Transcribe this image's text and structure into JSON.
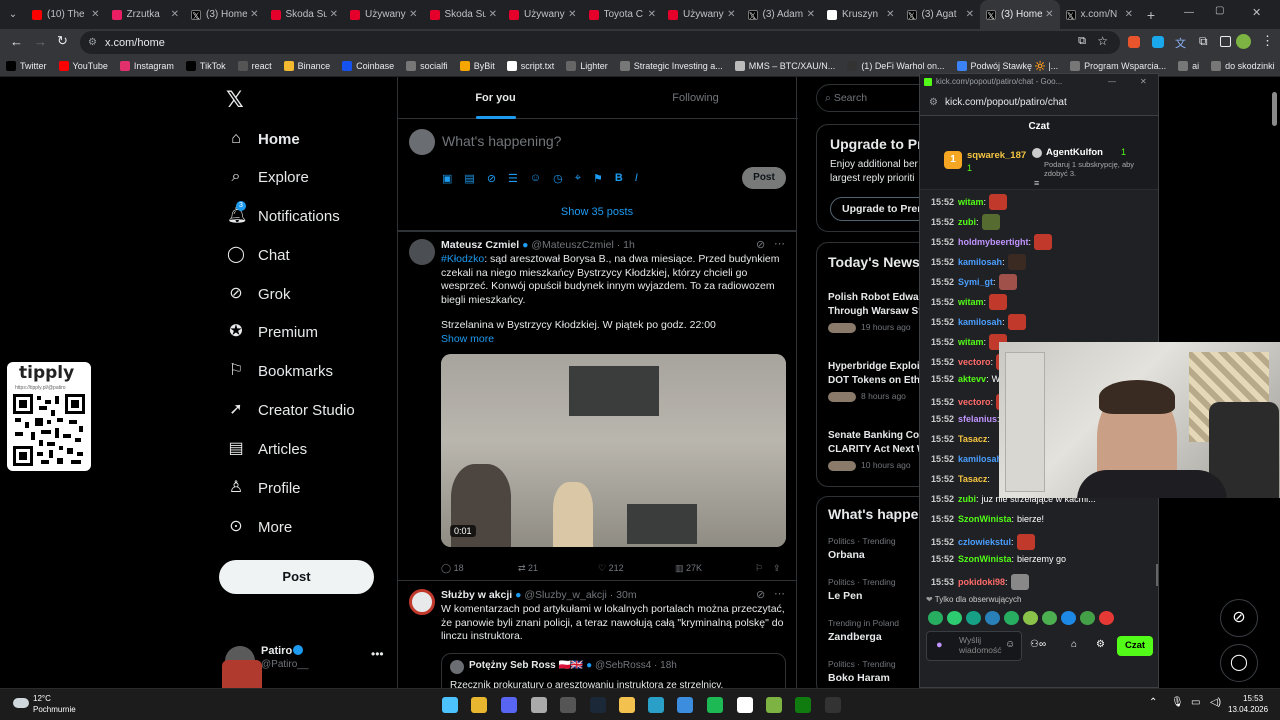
{
  "tabs": [
    {
      "title": "(10) The",
      "icon": "youtube-icon",
      "color": "#ff0000"
    },
    {
      "title": "Zrzutka",
      "icon": "zrzutka-icon",
      "color": "#e91e63"
    },
    {
      "title": "(3) Home",
      "icon": "x-icon",
      "color": "#000000"
    },
    {
      "title": "Skoda Su",
      "icon": "otomoto-icon",
      "color": "#e4002b"
    },
    {
      "title": "Używany",
      "icon": "otomoto-icon",
      "color": "#e4002b"
    },
    {
      "title": "Skoda Su",
      "icon": "otomoto-icon",
      "color": "#e4002b"
    },
    {
      "title": "Używany",
      "icon": "otomoto-icon",
      "color": "#e4002b"
    },
    {
      "title": "Toyota C",
      "icon": "toyota-icon",
      "color": "#e4002b"
    },
    {
      "title": "Używany",
      "icon": "otomoto-icon",
      "color": "#e4002b"
    },
    {
      "title": "(3) Adam",
      "icon": "x-icon",
      "color": "#000000"
    },
    {
      "title": "Kruszyn",
      "icon": "github-icon",
      "color": "#ffffff"
    },
    {
      "title": "(3) Agat",
      "icon": "x-icon",
      "color": "#000000"
    },
    {
      "title": "(3) Home",
      "icon": "x-icon",
      "color": "#000000"
    },
    {
      "title": "x.com/N",
      "icon": "x-icon",
      "color": "#000000"
    }
  ],
  "url": "x.com/home",
  "bookmarks": [
    "Twitter",
    "YouTube",
    "Instagram",
    "TikTok",
    "react",
    "Binance",
    "Coinbase",
    "socialfi",
    "ByBit",
    "script.txt",
    "Lighter",
    "Strategic Investing a...",
    "MMS – BTC/XAU/N...",
    "(1) DeFi Warhol on...",
    "Podwój Stawkę 🔆 |...",
    "Program Wsparcia...",
    "ai",
    "do skodzinki"
  ],
  "nav": {
    "home": "Home",
    "explore": "Explore",
    "notifications": "Notifications",
    "notif_badge": "3",
    "chat": "Chat",
    "grok": "Grok",
    "premium": "Premium",
    "bookmarks": "Bookmarks",
    "creator": "Creator Studio",
    "articles": "Articles",
    "profile": "Profile",
    "more": "More",
    "post": "Post"
  },
  "account": {
    "name": "Patiro",
    "handle": "@Patiro__"
  },
  "feed": {
    "tab_foryou": "For you",
    "tab_following": "Following",
    "composer": "What's happening?",
    "post": "Post",
    "show_posts": "Show 35 posts"
  },
  "tweet1": {
    "name": "Mateusz Czmiel",
    "handle": "@MateuszCzmiel · 1h",
    "hashtag": "#Kłodzko",
    "text": ": sąd aresztował Borysa B., na dwa miesiące. Przed budynkiem czekali na niego mieszkańcy Bystrzycy Kłodzkiej, którzy chcieli go wesprzeć. Konwój opuścił budynek innym wyjazdem. To za radiowozem biegli mieszkańcy.",
    "text2": "Strzelanina w Bystrzycy Kłodzkiej. W piątek po godz. 22:00",
    "more": "Show more",
    "duration": "0:01",
    "replies": "18",
    "reposts": "21",
    "likes": "212",
    "views": "27K"
  },
  "tweet2": {
    "name": "Służby w akcji",
    "handle": "@Sluzby_w_akcji · 30m",
    "text": "W komentarzach pod artykułami w lokalnych portalach można przeczytać, że panowie byli znani policji, a teraz nawołują całą \"kryminalną polskę\" do linczu instruktora.",
    "quote_name": "Potężny Seb Ross 🇵🇱🇬🇧",
    "quote_handle": "@SebRoss4 · 18h",
    "quote_text": "Rzecznik prokuratury o aresztowaniu instruktora ze strzelnicy."
  },
  "right": {
    "search": "Search",
    "premium_title": "Upgrade to Pre",
    "premium_text": "Enjoy additional ber largest reply prioriti",
    "premium_btn": "Upgrade to Prem",
    "news_title": "Today's News",
    "news": [
      {
        "t": "Polish Robot Edwar Through Warsaw St",
        "m": "19 hours ago"
      },
      {
        "t": "Hyperbridge Exploi DOT Tokens on Eth",
        "m": "8 hours ago"
      },
      {
        "t": "Senate Banking Co CLARITY Act Next W",
        "m": "10 hours ago"
      }
    ],
    "happening": "What's happen",
    "trends": [
      {
        "c": "Politics · Trending",
        "t": "Orbana"
      },
      {
        "c": "Politics · Trending",
        "t": "Le Pen"
      },
      {
        "c": "Trending in Poland",
        "t": "Zandberga"
      },
      {
        "c": "Politics · Trending",
        "t": "Boko Haram"
      }
    ]
  },
  "kick": {
    "window_title": "kick.com/popout/patiro/chat - Goo...",
    "url": "kick.com/popout/patiro/chat",
    "header": "Czat",
    "top1": "sqwarek_187",
    "top1_count": "1",
    "top2": "AgentKulfon",
    "top2_count": "1",
    "gift_text": "Podaruj 1 subskrypcję, aby zdobyć 3.",
    "followers_only": "Tylko dla obserwujących",
    "input": "Wyślij wiadomość",
    "send": "Czat",
    "messages": [
      {
        "time": "15:52",
        "user": "witam",
        "color": "#53fc18",
        "text": "",
        "emote": "#c0392b"
      },
      {
        "time": "15:52",
        "user": "zubi",
        "color": "#53fc18",
        "text": "",
        "emote": "#556b2f"
      },
      {
        "time": "15:52",
        "user": "holdmybeertight",
        "color": "#bf94ff",
        "text": "",
        "emote": "#c0392b"
      },
      {
        "time": "15:52",
        "user": "kamilosah",
        "color": "#4a9eff",
        "text": "",
        "emote": "#3a2a22"
      },
      {
        "time": "15:52",
        "user": "Symi_gt",
        "color": "#4a9eff",
        "text": "",
        "emote": "#a0524a"
      },
      {
        "time": "15:52",
        "user": "witam",
        "color": "#53fc18",
        "text": "",
        "emote": "#c0392b"
      },
      {
        "time": "15:52",
        "user": "kamilosah",
        "color": "#4a9eff",
        "text": "",
        "emote": "#c0392b"
      },
      {
        "time": "15:52",
        "user": "witam",
        "color": "#53fc18",
        "text": "",
        "emote": "#c0392b"
      },
      {
        "time": "15:52",
        "user": "vectoro",
        "color": "#ff6b6b",
        "text": "",
        "emote": "#c0392b"
      },
      {
        "time": "15:52",
        "user": "aktevv",
        "color": "#53fc18",
        "text": "We",
        "emote": ""
      },
      {
        "time": "15:52",
        "user": "vectoro",
        "color": "#ff6b6b",
        "text": "",
        "emote": "#c0392b"
      },
      {
        "time": "15:52",
        "user": "sfelanius",
        "color": "#bf94ff",
        "text": "",
        "emote": ""
      },
      {
        "time": "15:52",
        "user": "Tasacz",
        "color": "#f5c542",
        "text": "",
        "emote": ""
      },
      {
        "time": "15:52",
        "user": "kamilosah",
        "color": "#4a9eff",
        "text": "",
        "emote": ""
      },
      {
        "time": "15:52",
        "user": "Tasacz",
        "color": "#f5c542",
        "text": "",
        "emote": ""
      },
      {
        "time": "15:52",
        "user": "zubi",
        "color": "#53fc18",
        "text": "juz nie strzelające w kacmi...",
        "emote": ""
      },
      {
        "time": "15:52",
        "user": "SzonWinista",
        "color": "#53fc18",
        "text": "bierze!",
        "emote": ""
      },
      {
        "time": "15:52",
        "user": "czlowiekstul",
        "color": "#4a9eff",
        "text": "",
        "emote": "#c0392b"
      },
      {
        "time": "15:52",
        "user": "SzonWinista",
        "color": "#53fc18",
        "text": "bierzemy go",
        "emote": ""
      },
      {
        "time": "15:53",
        "user": "pokidoki98",
        "color": "#ff6b6b",
        "text": "",
        "emote": "#888888"
      }
    ]
  },
  "tippy": {
    "brand": "tipply",
    "url": "https://tipply.pl/@patiro"
  },
  "weather": {
    "temp": "12°C",
    "desc": "Pochmurnie"
  },
  "clock": {
    "time": "15:53",
    "date": "13.04.2026"
  },
  "overlay": "x17",
  "colors": {
    "accent": "#1d9bf0",
    "kick": "#53fc18",
    "bg": "#000000"
  }
}
